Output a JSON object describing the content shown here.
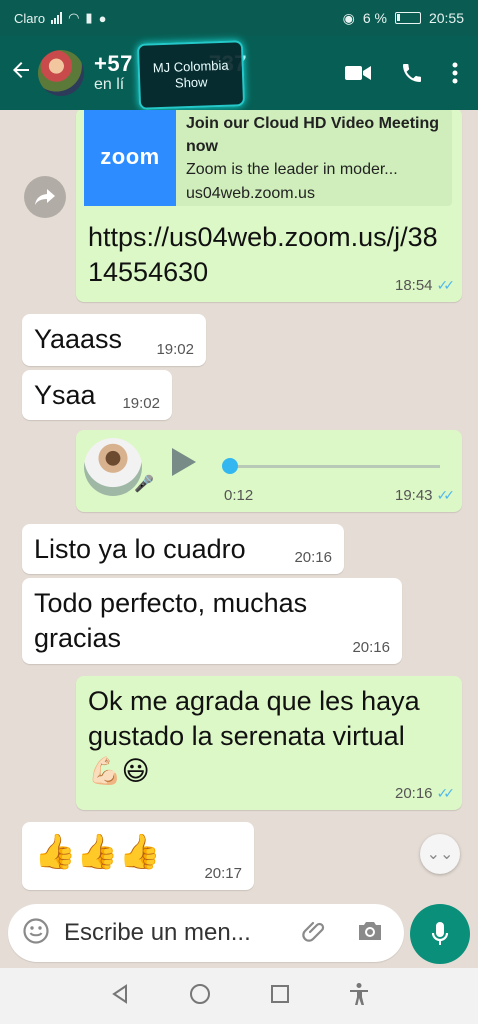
{
  "status_bar": {
    "carrier": "Claro",
    "battery_text": "6 %",
    "time": "20:55"
  },
  "header": {
    "contact_name": "+57",
    "contact_name_tail": "737",
    "status": "en lí"
  },
  "watermark": {
    "line1": "MJ Colombia",
    "line2": "Show"
  },
  "messages": [
    {
      "id": "m1",
      "direction": "outgoing",
      "link_preview": {
        "brand": "zoom",
        "title": "Join our Cloud HD Video Meeting now",
        "description": "Zoom is the leader in moder...",
        "domain": "us04web.zoom.us"
      },
      "text": "https://us04web.zoom.us/j/3814554630",
      "time": "18:54",
      "ticks": "read"
    },
    {
      "id": "m2",
      "direction": "incoming",
      "text": "Yaaass",
      "time": "19:02"
    },
    {
      "id": "m3",
      "direction": "incoming",
      "text": "Ysaa",
      "time": "19:02"
    },
    {
      "id": "m4",
      "direction": "outgoing",
      "type": "voice",
      "duration": "0:12",
      "progress": 0.0,
      "time": "19:43",
      "ticks": "read"
    },
    {
      "id": "m5",
      "direction": "incoming",
      "text": "Listo ya lo cuadro",
      "time": "20:16"
    },
    {
      "id": "m6",
      "direction": "incoming",
      "text": "Todo perfecto, muchas gracias",
      "time": "20:16"
    },
    {
      "id": "m7",
      "direction": "outgoing",
      "text": "Ok me agrada que les haya gustado la serenata virtual 💪🏻😃",
      "time": "20:16",
      "ticks": "read"
    },
    {
      "id": "m8",
      "direction": "incoming",
      "text": "👍👍👍",
      "time": "20:17"
    }
  ],
  "input": {
    "placeholder": "Escribe un men..."
  },
  "icons": {
    "back": "arrow-left-icon",
    "video": "video-call-icon",
    "call": "phone-icon",
    "menu": "more-vert-icon",
    "emoji": "emoji-icon",
    "attach": "paperclip-icon",
    "camera": "camera-icon",
    "mic": "microphone-icon",
    "scroll": "chevron-double-down-icon",
    "forward": "forward-icon"
  },
  "colors": {
    "header": "#075e54",
    "outgoing_bubble": "#dcf8c6",
    "incoming_bubble": "#ffffff",
    "read_ticks": "#4fb6ec",
    "mic_button": "#0a8f7a"
  }
}
